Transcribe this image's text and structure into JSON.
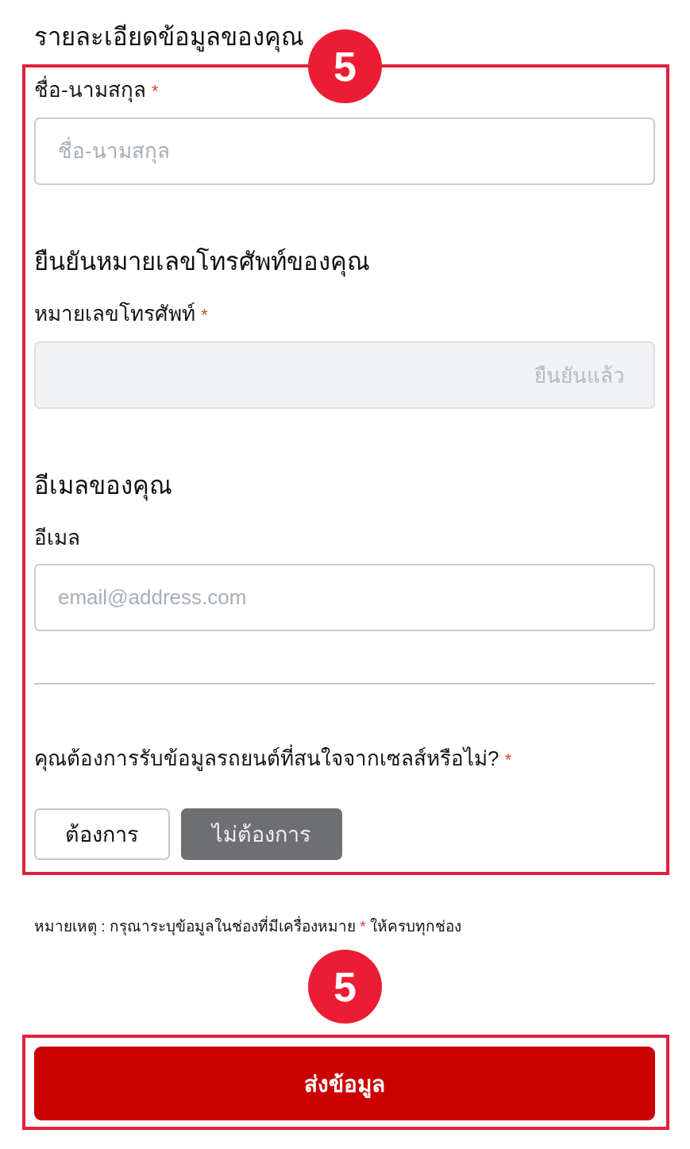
{
  "heading": "รายละเอียดข้อมูลของคุณ",
  "form_frame": {
    "badge": "5",
    "name_field": {
      "label": "ชื่อ-นามสกุล",
      "required_mark": "*",
      "placeholder": "ชื่อ-นามสกุล",
      "disabled": false
    },
    "phone_section": {
      "heading": "ยืนยันหมายเลขโทรศัพท์ของคุณ",
      "field": {
        "label": "หมายเลขโทรศัพท์",
        "required_mark": "*",
        "status": "ยืนยันแล้ว",
        "disabled": true
      }
    },
    "email_section": {
      "heading": "อีเมลของคุณ",
      "field": {
        "label": "อีเมล",
        "placeholder": "email@address.com",
        "disabled": false
      }
    },
    "sales_question": {
      "text": "คุณต้องการรับข้อมูลรถยนต์ที่สนใจจากเซลส์หรือไม่?",
      "required_mark": "*",
      "options": [
        {
          "label": "ต้องการ",
          "selected": false
        },
        {
          "label": "ไม่ต้องการ",
          "selected": true
        }
      ]
    }
  },
  "note": {
    "text_before": "หมายเหตุ : กรุณาระบุข้อมูลในช่องที่มีเครื่องหมาย",
    "marker": "*",
    "text_after": "ให้ครบทุกช่อง"
  },
  "submit_frame": {
    "badge": "5",
    "button": "ส่งข้อมูล"
  }
}
